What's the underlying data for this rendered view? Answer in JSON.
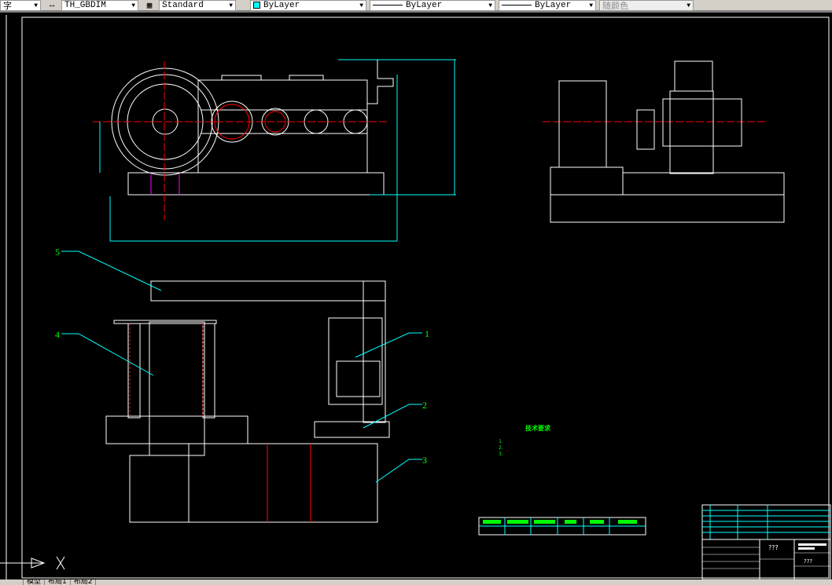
{
  "toolbar": {
    "text_style_partial": "字",
    "dim_style": "TH_GBDIM",
    "table_style": "Standard",
    "color": "ByLayer",
    "linetype": "ByLayer",
    "lineweight": "ByLayer",
    "plot_style": "随颜色",
    "accent_color": "#00ffff"
  },
  "drawing": {
    "balloons": [
      "1",
      "2",
      "3",
      "4",
      "5"
    ],
    "tech_title": "技术要求",
    "tech_lines": [
      "1.",
      "2.",
      "3."
    ],
    "title_block_name": "???",
    "title_block_drawing_no": "???"
  },
  "tabs": [
    "模型",
    "布局1",
    "布局2"
  ]
}
